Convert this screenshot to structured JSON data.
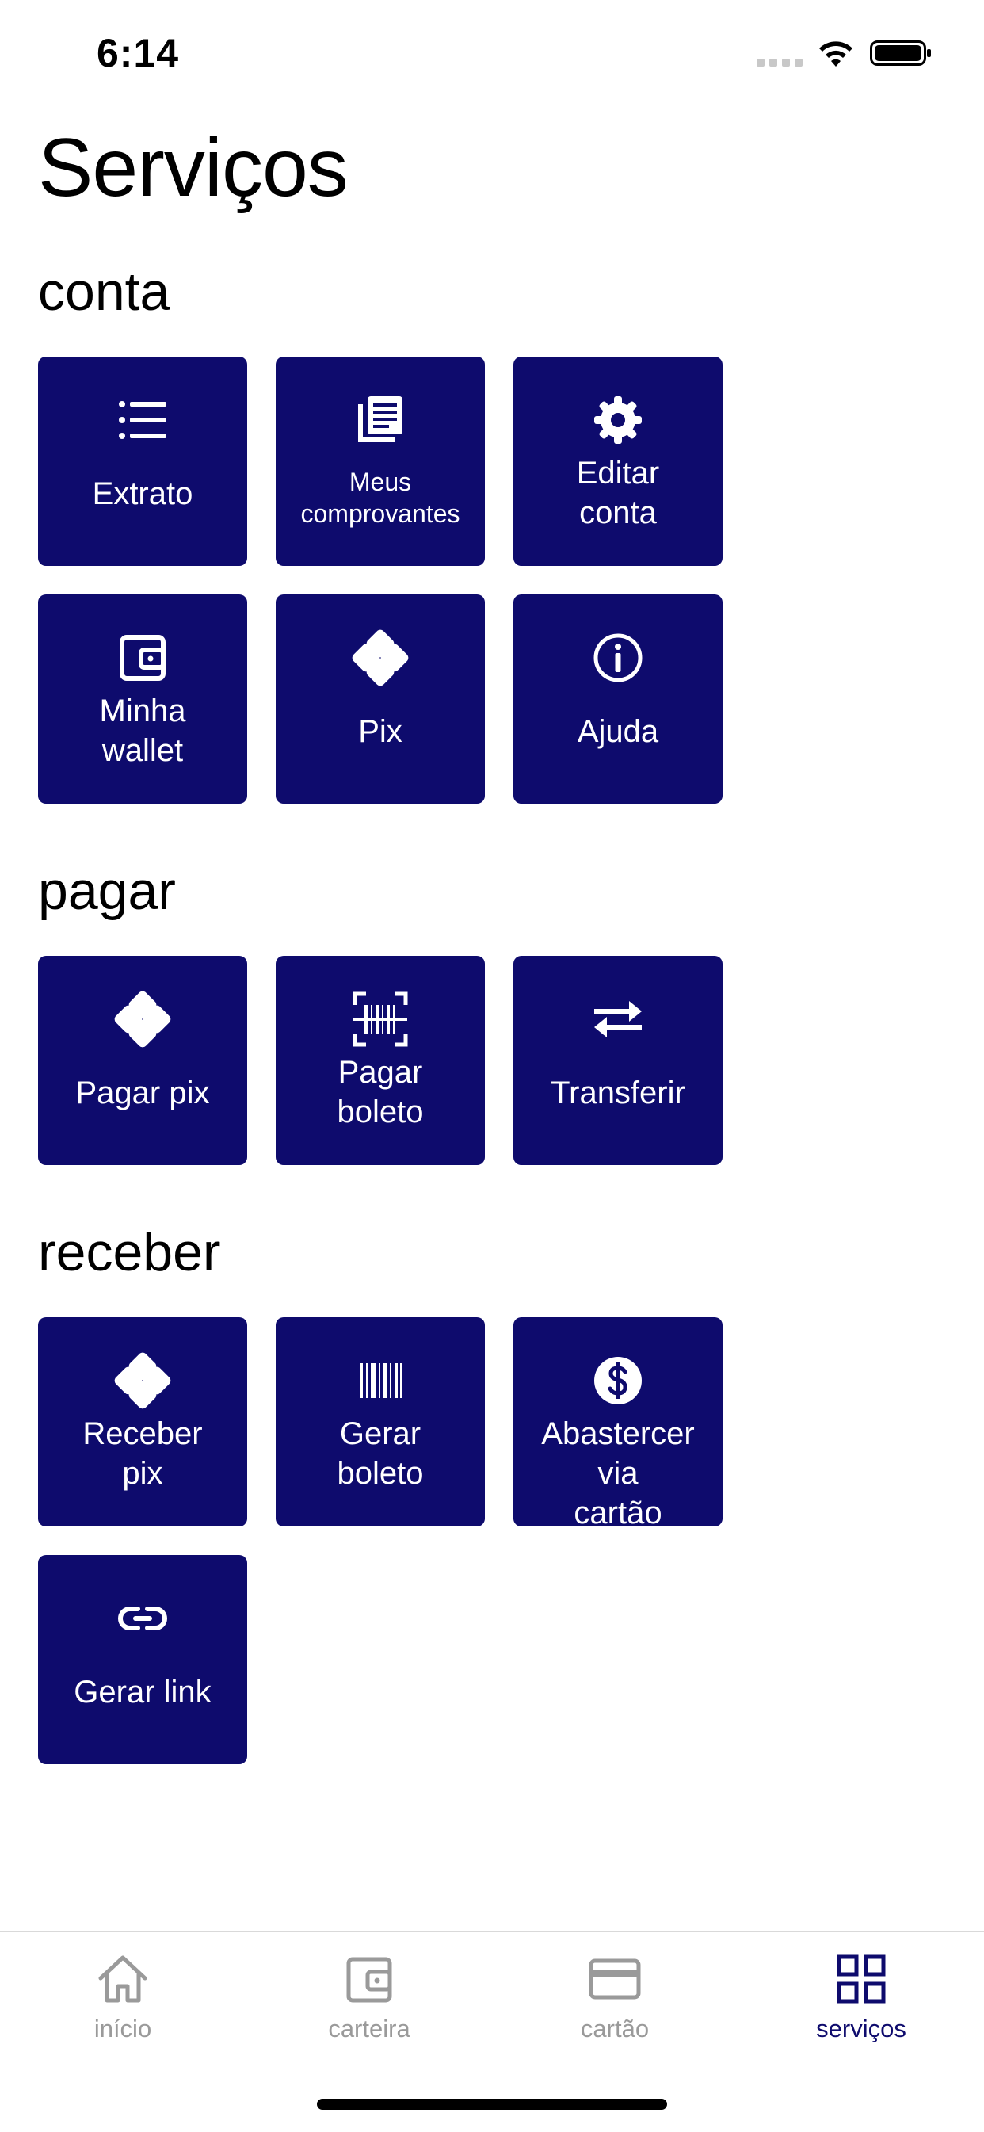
{
  "status_bar": {
    "time": "6:14"
  },
  "page": {
    "title": "Serviços"
  },
  "sections": {
    "conta": {
      "title": "conta",
      "tiles": {
        "extrato": {
          "label": "Extrato",
          "icon": "list-icon"
        },
        "comprovantes": {
          "label": "Meus comprovantes",
          "icon": "receipt-icon"
        },
        "editar_conta": {
          "label": "Editar conta",
          "icon": "gear-icon"
        },
        "wallet": {
          "label": "Minha wallet",
          "icon": "wallet-icon"
        },
        "pix": {
          "label": "Pix",
          "icon": "pix-icon"
        },
        "ajuda": {
          "label": "Ajuda",
          "icon": "info-icon"
        }
      }
    },
    "pagar": {
      "title": "pagar",
      "tiles": {
        "pagar_pix": {
          "label": "Pagar pix",
          "icon": "pix-icon"
        },
        "pagar_boleto": {
          "label": "Pagar boleto",
          "icon": "barcode-scan-icon"
        },
        "transferir": {
          "label": "Transferir",
          "icon": "transfer-arrows-icon"
        }
      }
    },
    "receber": {
      "title": "receber",
      "tiles": {
        "receber_pix": {
          "label": "Receber pix",
          "icon": "pix-icon"
        },
        "gerar_boleto": {
          "label": "Gerar boleto",
          "icon": "barcode-icon"
        },
        "abastecer": {
          "label": "Abastercer via cartão",
          "icon": "dollar-coin-icon"
        },
        "gerar_link": {
          "label": "Gerar link",
          "icon": "link-icon"
        }
      }
    }
  },
  "tab_bar": {
    "items": [
      {
        "label": "início",
        "icon": "home-icon",
        "active": false
      },
      {
        "label": "carteira",
        "icon": "wallet-icon",
        "active": false
      },
      {
        "label": "cartão",
        "icon": "credit-card-icon",
        "active": false
      },
      {
        "label": "serviços",
        "icon": "grid-icon",
        "active": true
      }
    ]
  },
  "colors": {
    "tile_background": "#0e0b6d",
    "tile_text": "#ffffff",
    "tab_active": "#0e0b6d",
    "tab_inactive": "#9a9a9a"
  }
}
